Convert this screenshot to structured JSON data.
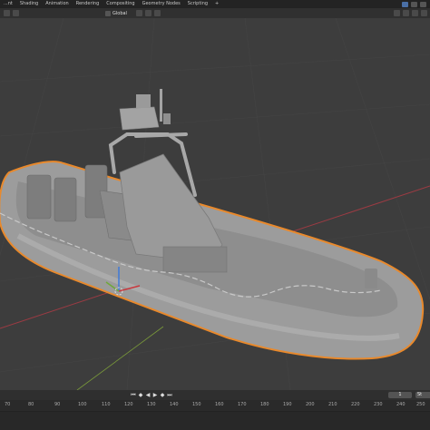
{
  "tabs": [
    "...nt",
    "Shading",
    "Animation",
    "Rendering",
    "Compositing",
    "Geometry Nodes",
    "Scripting",
    "+"
  ],
  "active_tab_index": -1,
  "orientation": "Global",
  "timeline": {
    "ticks": [
      "70",
      "80",
      "90",
      "100",
      "110",
      "120",
      "130",
      "140",
      "150",
      "160",
      "170",
      "180",
      "190",
      "200",
      "210",
      "220",
      "230",
      "240",
      "250"
    ],
    "current_frame": "1",
    "start_label": "St"
  },
  "colors": {
    "viewport_bg": "#3d3d3d",
    "selection_outline": "#e8892c",
    "mesh": "#a3a3a3",
    "x_axis": "#9c3b43",
    "y_axis": "#7a9a3a"
  },
  "icons": {
    "playback": [
      "jump-start-icon",
      "prev-keyframe-icon",
      "play-reverse-icon",
      "play-icon",
      "next-keyframe-icon",
      "jump-end-icon"
    ]
  }
}
